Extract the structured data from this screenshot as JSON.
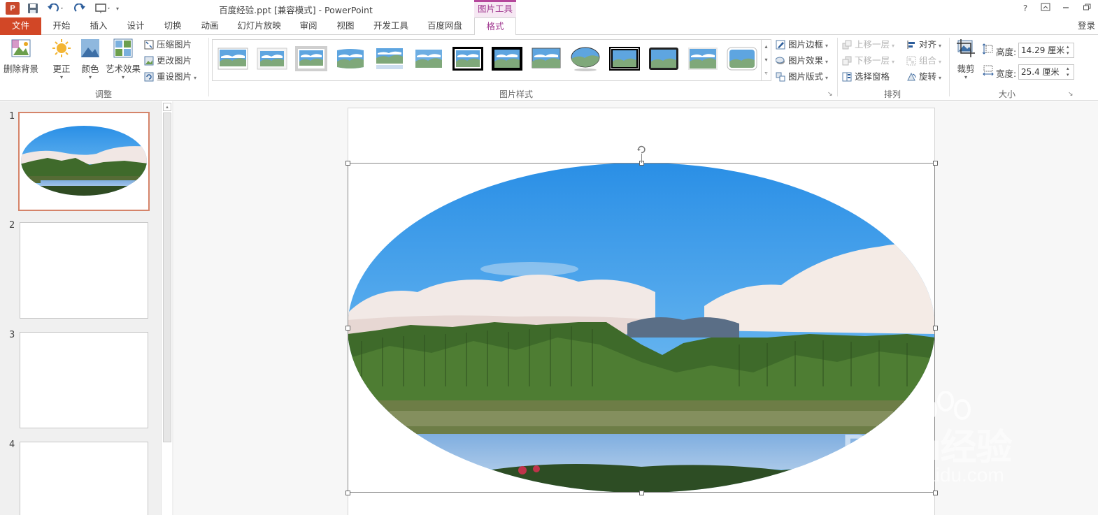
{
  "window": {
    "title": "百度经验.ppt [兼容模式] - PowerPoint",
    "context_tab_group": "图片工具",
    "help": "?",
    "ribbon_display": "⊼",
    "minimize": "—",
    "restore": "❐"
  },
  "tabs": [
    "文件",
    "开始",
    "插入",
    "设计",
    "切换",
    "动画",
    "幻灯片放映",
    "审阅",
    "视图",
    "开发工具",
    "百度网盘",
    "格式"
  ],
  "login": "登录",
  "ribbon": {
    "adjust": {
      "label": "调整",
      "remove_bg": "删除背景",
      "corrections": "更正",
      "color": "颜色",
      "artistic": "艺术效果",
      "compress": "压缩图片",
      "change": "更改图片",
      "reset": "重设图片"
    },
    "styles": {
      "label": "图片样式",
      "border": "图片边框",
      "effects": "图片效果",
      "layout": "图片版式"
    },
    "arrange": {
      "label": "排列",
      "bring_forward": "上移一层",
      "send_backward": "下移一层",
      "selection_pane": "选择窗格",
      "align": "对齐",
      "group": "组合",
      "rotate": "旋转"
    },
    "size": {
      "label": "大小",
      "crop": "裁剪",
      "height_label": "高度:",
      "height_value": "14.29 厘米",
      "width_label": "宽度:",
      "width_value": "25.4 厘米"
    }
  },
  "slides": [
    {
      "number": "1",
      "has_picture": true,
      "selected": true
    },
    {
      "number": "2"
    },
    {
      "number": "3"
    },
    {
      "number": "4"
    }
  ],
  "watermark": {
    "brand": "Baidu经验",
    "url": "jingyan.baidu.com"
  },
  "colors": {
    "file_tab": "#d24726",
    "context_accent": "#a13991",
    "selection_border": "#d5846a"
  }
}
